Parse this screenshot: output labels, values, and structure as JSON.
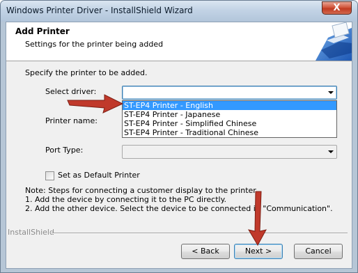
{
  "window": {
    "title": "Windows Printer Driver - InstallShield Wizard",
    "close_glyph": "X"
  },
  "header": {
    "title": "Add Printer",
    "subtitle": "Settings for the printer being added"
  },
  "form": {
    "instruction": "Specify the printer to be added.",
    "select_driver_label": "Select driver:",
    "printer_name_label": "Printer name:",
    "port_type_label": "Port Type:",
    "default_printer_label": "Set as Default Printer",
    "default_printer_checked": false
  },
  "driver_options": [
    {
      "label": "ST-EP4 Printer - English",
      "selected": true
    },
    {
      "label": "ST-EP4 Printer - Japanese",
      "selected": false
    },
    {
      "label": "ST-EP4 Printer - Simplified Chinese",
      "selected": false
    },
    {
      "label": "ST-EP4 Printer - Traditional Chinese",
      "selected": false
    }
  ],
  "note": {
    "line1": "Note: Steps for connecting a customer display to the printer",
    "line2": "1. Add the device by connecting it to the PC directly.",
    "line3": "2. Add the other device. Select the device to be connected in \"Communication\"."
  },
  "footer": {
    "brand": "InstallShield",
    "back_label": "< Back",
    "next_label": "Next >",
    "cancel_label": "Cancel"
  },
  "annotations": {
    "arrow_color": "#c0392b"
  }
}
